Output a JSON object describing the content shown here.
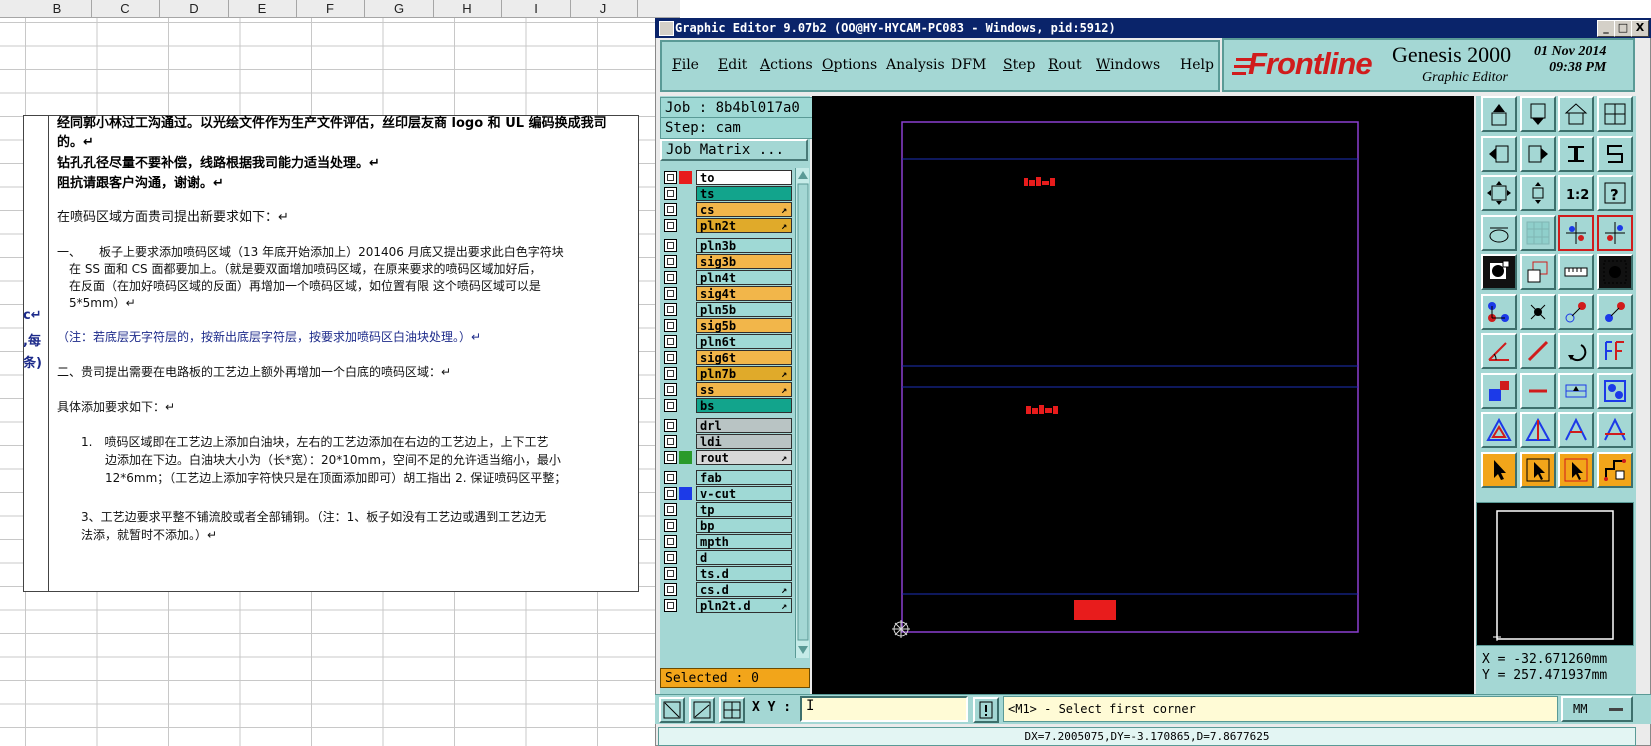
{
  "spreadsheet": {
    "columns": [
      "B",
      "C",
      "D",
      "E",
      "F",
      "G",
      "H",
      "I",
      "J"
    ],
    "side_fragments": [
      "с↵",
      ",每",
      "条)"
    ]
  },
  "document": {
    "lines": [
      {
        "text": "经同郭小林过工沟通过。以光绘文件作为生产文件评估，丝印层友商 logo 和 UL 编码换成我司",
        "style": "b"
      },
      {
        "text": "的。↵",
        "style": "b"
      },
      {
        "text": "钻孔孔径尽量不要补偿，线路根据我司能力适当处理。↵",
        "style": "b"
      },
      {
        "text": "阻抗请跟客户沟通，谢谢。↵",
        "style": "b"
      },
      {
        "text": "在喷码区域方面贵司提出新要求如下：↵",
        "style": ""
      },
      {
        "text": "一、　　板子上要求添加喷码区域（13 年底开始添加上）201406 月底又提出要求此白色字符块",
        "style": ""
      },
      {
        "text": "　在 SS 面和 CS 面都要加上。（就是要双面增加喷码区域，在原来要求的喷码区域加好后，",
        "style": ""
      },
      {
        "text": "　在反面（在加好喷码区域的反面）再增加一个喷码区域，如位置有限 这个喷码区域可以是",
        "style": ""
      },
      {
        "text": "　5*5mm）↵",
        "style": ""
      },
      {
        "text": "（注：若底层无字符层的，按新出底层字符层，按要求加喷码区白油块处理。）↵",
        "style": "blue"
      },
      {
        "text": "二、贵司提出需要在电路板的工艺边上额外再增加一个白底的喷码区域：↵",
        "style": ""
      },
      {
        "text": "具体添加要求如下：↵",
        "style": ""
      },
      {
        "text": "　　1.　喷码区域即在工艺边上添加白油块，左右的工艺边添加在右边的工艺边上，上下工艺",
        "style": ""
      },
      {
        "text": "　　　　边添加在下边。白油块大小为（长*宽）：20*10mm，空间不足的允许适当缩小，最小",
        "style": ""
      },
      {
        "text": "　　　　12*6mm；（工艺边上添加字符快只是在顶面添加即可）胡工指出 2. 保证喷码区平整；",
        "style": ""
      },
      {
        "text": "　　3、工艺边要求平整不铺流胶或者全部铺铜。（注：1、板子如没有工艺边或遇到工艺边无",
        "style": ""
      },
      {
        "text": "　　法添，就暂时不添加。）↵",
        "style": ""
      }
    ]
  },
  "window": {
    "title": "Graphic Editor 9.07b2 (OO@HY-HYCAM-PC083 - Windows, pid:5912)",
    "buttons": [
      "_",
      "□",
      "X"
    ]
  },
  "menu": [
    {
      "label": "File",
      "u": "F"
    },
    {
      "label": "Edit",
      "u": "E"
    },
    {
      "label": "Actions",
      "u": "A"
    },
    {
      "label": "Options",
      "u": "O"
    },
    {
      "label": "Analysis",
      "u": ""
    },
    {
      "label": "DFM",
      "u": ""
    },
    {
      "label": "Step",
      "u": "S"
    },
    {
      "label": "Rout",
      "u": "R"
    },
    {
      "label": "Windows",
      "u": "W"
    },
    {
      "label": "Help",
      "u": ""
    }
  ],
  "brand": {
    "logo": "Frontline",
    "product": "Genesis 2000",
    "subtitle": "Graphic Editor",
    "date": "01 Nov 2014",
    "time": "09:38 PM"
  },
  "job": {
    "job": "Job : 8b4bl017a0",
    "step": "Step: cam",
    "matrix": "Job Matrix ..."
  },
  "layers": [
    {
      "name": "to",
      "bg": "#ffffff",
      "color": "#e81c1c",
      "mark": ""
    },
    {
      "name": "ts",
      "bg": "#12a48c",
      "color": "",
      "mark": ""
    },
    {
      "name": "cs",
      "bg": "#f2b64a",
      "color": "",
      "mark": "↗"
    },
    {
      "name": "pln2t",
      "bg": "#e0aa2a",
      "color": "",
      "mark": "↗"
    },
    {
      "name": "pln3b",
      "bg": "#9fd9d5",
      "color": "",
      "mark": ""
    },
    {
      "name": "sig3b",
      "bg": "#f2b64a",
      "color": "",
      "mark": ""
    },
    {
      "name": "pln4t",
      "bg": "#9fd9d5",
      "color": "",
      "mark": ""
    },
    {
      "name": "sig4t",
      "bg": "#f2b64a",
      "color": "",
      "mark": ""
    },
    {
      "name": "pln5b",
      "bg": "#9fd9d5",
      "color": "",
      "mark": ""
    },
    {
      "name": "sig5b",
      "bg": "#f2b64a",
      "color": "",
      "mark": ""
    },
    {
      "name": "pln6t",
      "bg": "#9fd9d5",
      "color": "",
      "mark": ""
    },
    {
      "name": "sig6t",
      "bg": "#f2b64a",
      "color": "",
      "mark": ""
    },
    {
      "name": "pln7b",
      "bg": "#e0aa2a",
      "color": "",
      "mark": "↗"
    },
    {
      "name": "ss",
      "bg": "#f2b64a",
      "color": "",
      "mark": "↗"
    },
    {
      "name": "bs",
      "bg": "#12a48c",
      "color": "",
      "mark": ""
    },
    {
      "name": "drl",
      "bg": "#b9c4c4",
      "color": "",
      "mark": ""
    },
    {
      "name": "ldi",
      "bg": "#b9c4c4",
      "color": "",
      "mark": ""
    },
    {
      "name": "rout",
      "bg": "#d8d8d8",
      "color": "#2a9a2a",
      "mark": "↗"
    },
    {
      "name": "fab",
      "bg": "#9fd9d5",
      "color": "",
      "mark": ""
    },
    {
      "name": "v-cut",
      "bg": "#9fd9d5",
      "color": "#1c3ae8",
      "mark": ""
    },
    {
      "name": "tp",
      "bg": "#9fd9d5",
      "color": "",
      "mark": ""
    },
    {
      "name": "bp",
      "bg": "#9fd9d5",
      "color": "",
      "mark": ""
    },
    {
      "name": "mpth",
      "bg": "#9fd9d5",
      "color": "",
      "mark": ""
    },
    {
      "name": "d",
      "bg": "#9fd9d5",
      "color": "",
      "mark": ""
    },
    {
      "name": "ts.d",
      "bg": "#9fd9d5",
      "color": "",
      "mark": ""
    },
    {
      "name": "cs.d",
      "bg": "#9fd9d5",
      "color": "",
      "mark": "↗"
    },
    {
      "name": "pln2t.d",
      "bg": "#9fd9d5",
      "color": "",
      "mark": "↗"
    }
  ],
  "selected": "Selected : 0",
  "coords": {
    "x": "X = -32.671260mm",
    "y": "Y = 257.471937mm"
  },
  "bottom": {
    "xy_label": "X Y :",
    "xy_value": "I",
    "message": "<M1> - Select first corner",
    "units": "MM",
    "status": "DX=7.2005075,DY=-3.170865,D=7.8677625"
  },
  "colors": {
    "accent": "#a4d7d4",
    "board_outline": "#8a3fd0",
    "grid_line": "#1c2fb8",
    "feature": "#e81c1c"
  },
  "tool_icons": [
    "home-icon",
    "open-job-icon",
    "house-icon",
    "window-icon",
    "prev-icon",
    "next-icon",
    "step-icon",
    "s-icon",
    "zoom-fit-icon",
    "zoom-in-icon",
    "scale-icon",
    "help-icon",
    "measure-icon",
    "grid-icon",
    "snap-icon",
    "snap2-icon",
    "feature-icon",
    "select-rect-icon",
    "ruler-icon",
    "circle-icon",
    "net-icon",
    "cross-icon",
    "move-icon",
    "dot-icon",
    "line-icon",
    "diagonal-icon",
    "rotate-icon",
    "pin-icon",
    "fill-icon",
    "minus-icon",
    "stretch-icon",
    "group-icon",
    "triangle-icon",
    "arrow-up-icon",
    "arc-icon",
    "arc2-icon",
    "pointer-icon",
    "pointer-box-icon",
    "pointer-box2-icon",
    "route-icon"
  ]
}
